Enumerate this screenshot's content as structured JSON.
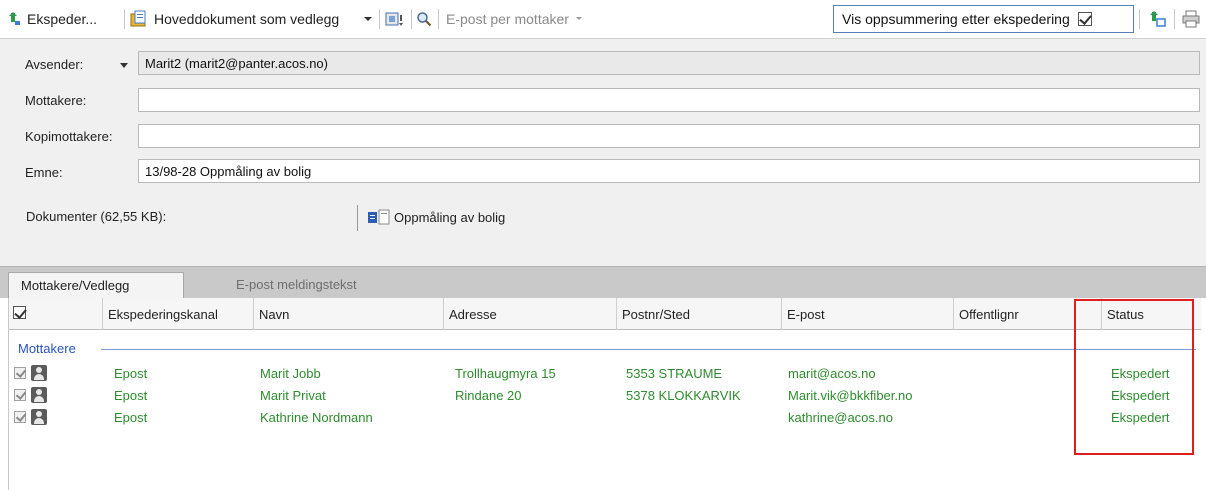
{
  "toolbar": {
    "ekspeder_label": "Ekspeder...",
    "hoveddokument_label": "Hoveddokument som vedlegg",
    "epost_per_mottaker_label": "E-post per mottaker",
    "summary_label": "Vis oppsummering etter ekspedering",
    "summary_checked": true
  },
  "form": {
    "avsender_label": "Avsender:",
    "avsender_value": "Marit2 (marit2@panter.acos.no)",
    "mottakere_label": "Mottakere:",
    "mottakere_value": "",
    "kopimottakere_label": "Kopimottakere:",
    "kopimottakere_value": "",
    "emne_label": "Emne:",
    "emne_value": "13/98-28 Oppmåling av bolig",
    "dokumenter_label": "Dokumenter (62,55 KB):",
    "dokument_name": "Oppmåling av bolig"
  },
  "tabs": [
    {
      "label": "Mottakere/Vedlegg",
      "active": true
    },
    {
      "label": "E-post meldingstekst",
      "active": false
    }
  ],
  "grid": {
    "columns": [
      "Ekspederingskanal",
      "Navn",
      "Adresse",
      "Postnr/Sted",
      "E-post",
      "Offentlignr",
      "Status"
    ],
    "group_label": "Mottakere",
    "rows": [
      {
        "kanal": "Epost",
        "navn": "Marit Jobb",
        "adresse": "Trollhaugmyra 15",
        "postnr": "5353 STRAUME",
        "epost": "marit@acos.no",
        "offentlignr": "",
        "status": "Ekspedert"
      },
      {
        "kanal": "Epost",
        "navn": "Marit Privat",
        "adresse": "Rindane 20",
        "postnr": "5378 KLOKKARVIK",
        "epost": "Marit.vik@bkkfiber.no",
        "offentlignr": "",
        "status": "Ekspedert"
      },
      {
        "kanal": "Epost",
        "navn": "Kathrine Nordmann",
        "adresse": "",
        "postnr": "",
        "epost": "kathrine@acos.no",
        "offentlignr": "",
        "status": "Ekspedert"
      }
    ]
  },
  "colors": {
    "status_green": "#2e8b2e",
    "group_blue": "#2a52be",
    "annotation_red": "#e01e1e"
  }
}
